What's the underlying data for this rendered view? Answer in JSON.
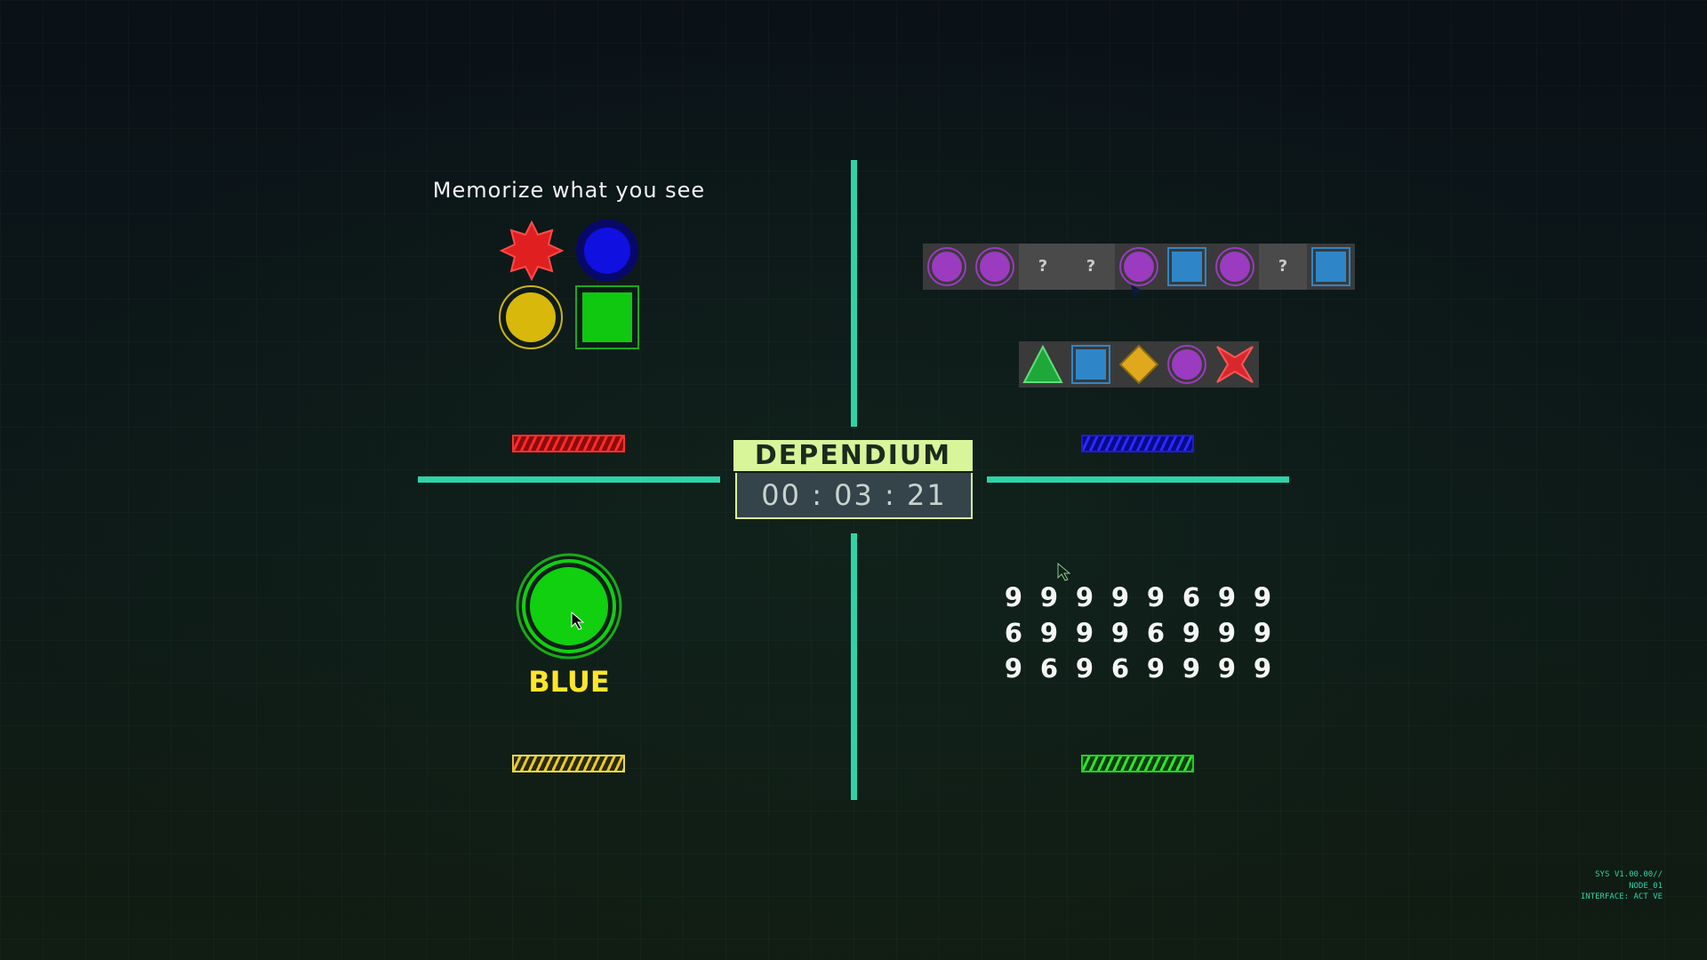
{
  "game": {
    "title": "DEPENDIUM",
    "timer": "00 : 03 : 21"
  },
  "memory_panel": {
    "instruction": "Memorize what you see",
    "shapes": [
      {
        "shape": "star",
        "color": "#e02020"
      },
      {
        "shape": "circle",
        "color": "#1010e0"
      },
      {
        "shape": "circle",
        "color": "#d8b80a"
      },
      {
        "shape": "square",
        "color": "#10c810"
      }
    ],
    "progress_color": "#ff2a2a"
  },
  "sequence_panel": {
    "sequence": [
      {
        "shape": "circle",
        "color": "#9b3bc0"
      },
      {
        "shape": "circle",
        "color": "#9b3bc0"
      },
      {
        "shape": "unknown",
        "label": "?"
      },
      {
        "shape": "unknown",
        "label": "?"
      },
      {
        "shape": "circle",
        "color": "#9b3bc0"
      },
      {
        "shape": "square",
        "color": "#2e86c9"
      },
      {
        "shape": "circle",
        "color": "#9b3bc0"
      },
      {
        "shape": "unknown",
        "label": "?"
      },
      {
        "shape": "square",
        "color": "#2e86c9"
      }
    ],
    "options": [
      {
        "shape": "triangle",
        "color": "#1fa83a"
      },
      {
        "shape": "square",
        "color": "#2e86c9"
      },
      {
        "shape": "diamond",
        "color": "#e0a81c"
      },
      {
        "shape": "circle",
        "color": "#9b3bc0"
      },
      {
        "shape": "x-star",
        "color": "#d8282e"
      }
    ],
    "progress_color": "#2a2aff"
  },
  "color_panel": {
    "button_color": "#10d010",
    "word": "BLUE",
    "word_color": "#ffe52a",
    "progress_color": "#e7c92c"
  },
  "digit_panel": {
    "rows": [
      [
        "9",
        "9",
        "9",
        "9",
        "9",
        "6",
        "9",
        "9"
      ],
      [
        "6",
        "9",
        "9",
        "9",
        "6",
        "9",
        "9",
        "9"
      ],
      [
        "9",
        "6",
        "9",
        "6",
        "9",
        "9",
        "9",
        "9"
      ]
    ],
    "progress_color": "#33e033"
  },
  "system_info": {
    "line1": "SYS V1.00.00//",
    "line2": "NODE_01",
    "line3": "INTERFACE: ACT VE"
  }
}
